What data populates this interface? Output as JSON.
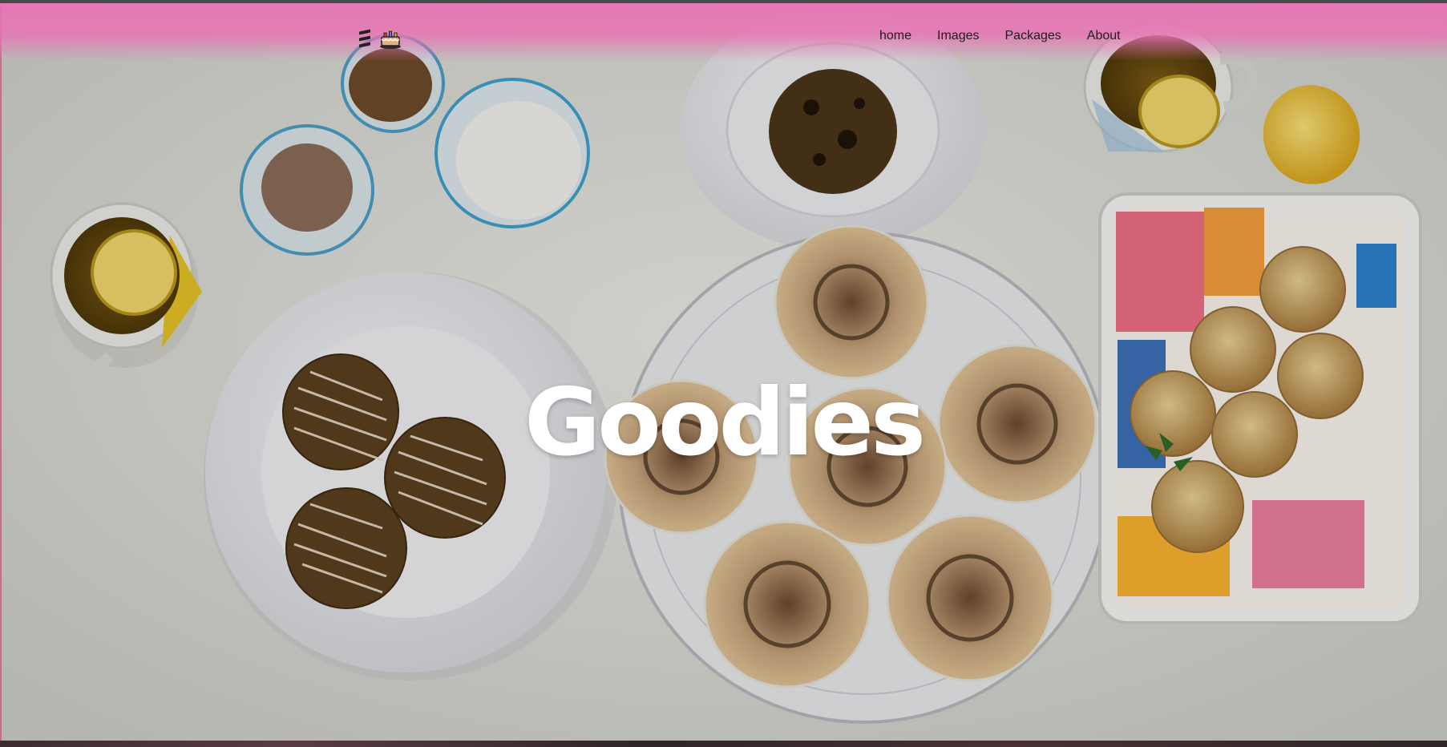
{
  "nav": {
    "links": [
      "home",
      "Images",
      "Packages",
      "About"
    ]
  },
  "hero": {
    "title": "Goodies"
  },
  "theme": {
    "navbar_color": "#e874b4",
    "title_color": "#ffffff",
    "link_color": "#1e1e1e"
  },
  "icons": {
    "brand_menu": "menu-icon",
    "brand_logo": "cake-icon"
  }
}
